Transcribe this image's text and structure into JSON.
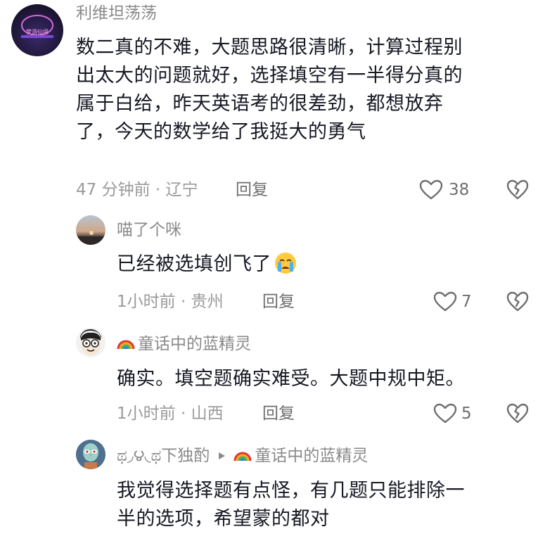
{
  "comments": [
    {
      "username": "利维坦荡荡",
      "avatar_label": "梦游仙境",
      "lines": [
        "数二真的不难，大题思路很清晰，计算过程别",
        "出太大的问题就好，选择填空有一半得分真的",
        "属于白给，昨天英语考的很差劲，都想放弃",
        "了，今天的数学给了我挺大的勇气"
      ],
      "meta": "47 分钟前 · 辽宁",
      "reply": "回复",
      "likes": "38"
    },
    {
      "username": "喵了个咪",
      "text": "已经被选填创飞了",
      "emoji": "crying-face",
      "meta": "1小时前 · 贵州",
      "reply": "回复",
      "likes": "7"
    },
    {
      "username": "童话中的蓝精灵",
      "username_icon": "rainbow",
      "text": "确实。填空题确实难受。大题中规中矩。",
      "meta": "1小时前 · 山西",
      "reply": "回复",
      "likes": "5"
    },
    {
      "username": "ಥ◞౪◟ಥ下独酌",
      "reply_to": "童话中的蓝精灵",
      "reply_to_icon": "rainbow",
      "lines": [
        "我觉得选择题有点怪，有几题只能排除一",
        "半的选项，希望蒙的都对"
      ]
    }
  ],
  "colors": {
    "text": "#161823",
    "meta": "#9a9a9a",
    "name": "#8a8a8a"
  }
}
